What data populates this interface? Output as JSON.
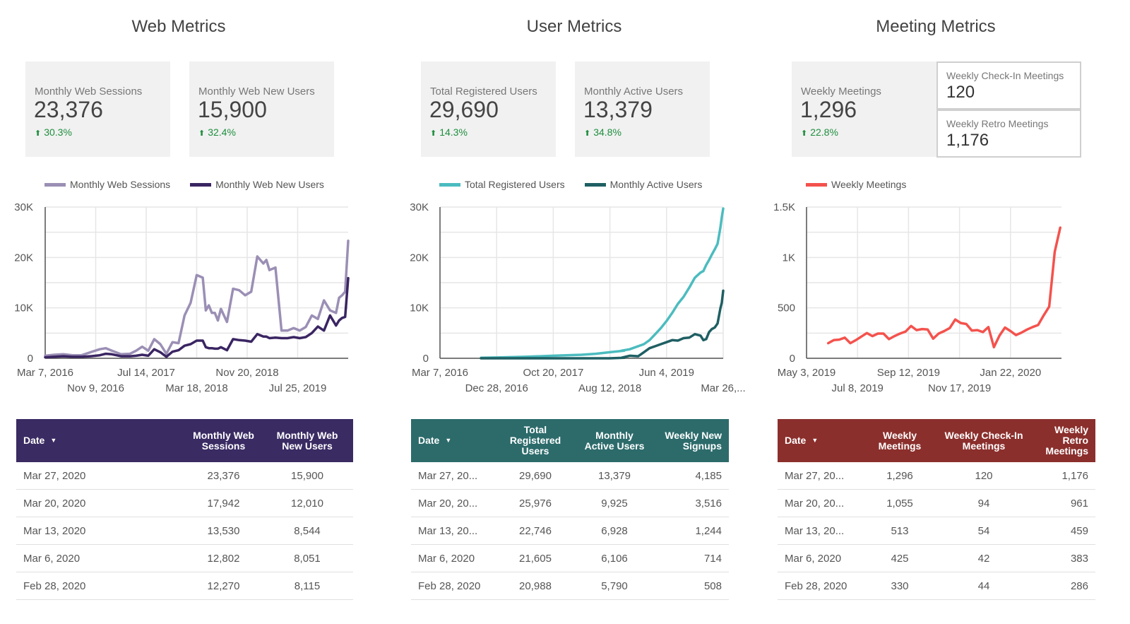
{
  "sections": [
    {
      "title": "Web Metrics",
      "cards": [
        {
          "label": "Monthly Web Sessions",
          "value": "23,376",
          "delta": "30.3%",
          "delta_direction": "up"
        },
        {
          "label": "Monthly Web New Users",
          "value": "15,900",
          "delta": "32.4%",
          "delta_direction": "up"
        }
      ],
      "table": {
        "header_color": "#3a2b63",
        "sort_icon": "triangle-down",
        "columns": [
          "Date",
          "Monthly Web Sessions",
          "Monthly Web New Users"
        ],
        "rows": [
          [
            "Mar 27, 2020",
            "23,376",
            "15,900"
          ],
          [
            "Mar 20, 2020",
            "17,942",
            "12,010"
          ],
          [
            "Mar 13, 2020",
            "13,530",
            "8,544"
          ],
          [
            "Mar 6, 2020",
            "12,802",
            "8,051"
          ],
          [
            "Feb 28, 2020",
            "12,270",
            "8,115"
          ]
        ]
      }
    },
    {
      "title": "User Metrics",
      "cards": [
        {
          "label": "Total Registered Users",
          "value": "29,690",
          "delta": "14.3%",
          "delta_direction": "up"
        },
        {
          "label": "Monthly Active Users",
          "value": "13,379",
          "delta": "34.8%",
          "delta_direction": "up"
        }
      ],
      "table": {
        "header_color": "#2d6b6b",
        "sort_icon": "triangle-down",
        "columns": [
          "Date",
          "Total Registered Users",
          "Monthly Active Users",
          "Weekly New Signups"
        ],
        "rows": [
          [
            "Mar 27, 20...",
            "29,690",
            "13,379",
            "4,185"
          ],
          [
            "Mar 20, 20...",
            "25,976",
            "9,925",
            "3,516"
          ],
          [
            "Mar 13, 20...",
            "22,746",
            "6,928",
            "1,244"
          ],
          [
            "Mar 6, 2020",
            "21,605",
            "6,106",
            "714"
          ],
          [
            "Feb 28, 2020",
            "20,988",
            "5,790",
            "508"
          ]
        ]
      }
    },
    {
      "title": "Meeting Metrics",
      "cards": [
        {
          "label": "Weekly Meetings",
          "value": "1,296",
          "delta": "22.8%",
          "delta_direction": "up"
        }
      ],
      "mini_cards": [
        {
          "label": "Weekly Check-In Meetings",
          "value": "120"
        },
        {
          "label": "Weekly Retro Meetings",
          "value": "1,176"
        }
      ],
      "table": {
        "header_color": "#8b2f2c",
        "sort_icon": "triangle-down",
        "columns": [
          "Date",
          "Weekly Meetings",
          "Weekly Check-In Meetings",
          "Weekly Retro Meetings"
        ],
        "rows": [
          [
            "Mar 27, 20...",
            "1,296",
            "120",
            "1,176"
          ],
          [
            "Mar 20, 20...",
            "1,055",
            "94",
            "961"
          ],
          [
            "Mar 13, 20...",
            "513",
            "54",
            "459"
          ],
          [
            "Mar 6, 2020",
            "425",
            "42",
            "383"
          ],
          [
            "Feb 28, 2020",
            "330",
            "44",
            "286"
          ]
        ]
      }
    }
  ],
  "chart_data": [
    {
      "type": "line",
      "title": "Web Metrics",
      "xlabel": "",
      "ylabel": "",
      "x_range": [
        "Mar 7, 2016",
        "Mar 27, 2020"
      ],
      "x_ticks": [
        "Mar 7, 2016",
        "Nov 9, 2016",
        "Jul 14, 2017",
        "Mar 18, 2018",
        "Nov 20, 2018",
        "Jul 25, 2019"
      ],
      "y_ticks": [
        "0",
        "10K",
        "20K",
        "30K"
      ],
      "ylim": [
        0,
        30000
      ],
      "grid": true,
      "legend": "top",
      "x_fraction": [
        0,
        0.03,
        0.06,
        0.09,
        0.12,
        0.15,
        0.18,
        0.2,
        0.22,
        0.25,
        0.28,
        0.3,
        0.32,
        0.34,
        0.36,
        0.38,
        0.4,
        0.42,
        0.44,
        0.46,
        0.48,
        0.5,
        0.52,
        0.53,
        0.54,
        0.55,
        0.56,
        0.57,
        0.58,
        0.6,
        0.62,
        0.64,
        0.66,
        0.68,
        0.7,
        0.72,
        0.73,
        0.74,
        0.76,
        0.78,
        0.8,
        0.82,
        0.84,
        0.86,
        0.88,
        0.9,
        0.92,
        0.94,
        0.96,
        0.97,
        0.98,
        0.99,
        1.0
      ],
      "series": [
        {
          "name": "Monthly Web Sessions",
          "color": "#9b8fb5",
          "values": [
            500,
            700,
            800,
            600,
            600,
            1200,
            1800,
            2000,
            1500,
            800,
            900,
            1500,
            2300,
            1500,
            3800,
            2800,
            900,
            3200,
            3000,
            8500,
            11000,
            16500,
            16000,
            9500,
            10500,
            9000,
            9000,
            7500,
            9800,
            7200,
            13800,
            13500,
            12500,
            13200,
            20200,
            18800,
            19500,
            17500,
            18000,
            5500,
            5500,
            6000,
            5500,
            6200,
            8500,
            7800,
            11500,
            9500,
            9000,
            12000,
            12500,
            13200,
            23300
          ]
        },
        {
          "name": "Monthly Web New Users",
          "color": "#3a2562",
          "values": [
            200,
            300,
            400,
            300,
            300,
            400,
            600,
            900,
            800,
            400,
            400,
            500,
            700,
            500,
            1800,
            1200,
            300,
            1300,
            1600,
            2500,
            2800,
            3500,
            3500,
            2200,
            2000,
            2000,
            1900,
            1900,
            2200,
            1600,
            3800,
            3600,
            3500,
            3300,
            4800,
            4300,
            4300,
            4000,
            4100,
            4000,
            4000,
            4200,
            4000,
            4200,
            5000,
            6300,
            5500,
            8500,
            6500,
            7500,
            8000,
            8200,
            15900
          ]
        }
      ]
    },
    {
      "type": "line",
      "title": "User Metrics",
      "xlabel": "",
      "ylabel": "",
      "x_range": [
        "Mar 7, 2016",
        "Mar 27, 2020"
      ],
      "x_ticks": [
        "Mar 7, 2016",
        "Dec 28, 2016",
        "Oct 20, 2017",
        "Aug 12, 2018",
        "Jun 4, 2019",
        "Mar 26,..."
      ],
      "y_ticks": [
        "0",
        "10K",
        "20K",
        "30K"
      ],
      "ylim": [
        0,
        30000
      ],
      "grid": true,
      "legend": "top",
      "x_fraction": [
        0.145,
        0.2,
        0.3,
        0.4,
        0.5,
        0.55,
        0.6,
        0.65,
        0.64,
        0.67,
        0.7,
        0.72,
        0.74,
        0.76,
        0.78,
        0.8,
        0.82,
        0.84,
        0.86,
        0.88,
        0.9,
        0.92,
        0.93,
        0.94,
        0.95,
        0.96,
        0.97,
        0.98,
        0.99,
        0.995,
        1.0
      ],
      "series": [
        {
          "name": "Total Registered Users",
          "color": "#4bbcbf",
          "values": [
            100,
            150,
            300,
            500,
            700,
            900,
            1200,
            1500,
            1500,
            1800,
            2400,
            2800,
            3600,
            4800,
            6000,
            7400,
            9000,
            10800,
            12200,
            14000,
            16000,
            17000,
            17300,
            18500,
            19500,
            20600,
            21600,
            22700,
            25900,
            28000,
            29700
          ]
        },
        {
          "name": "Monthly Active Users",
          "color": "#1f5f63",
          "values": [
            0,
            0,
            0,
            0,
            0,
            0,
            0,
            100,
            100,
            500,
            400,
            1200,
            2000,
            2400,
            2800,
            3200,
            3600,
            3500,
            4000,
            4100,
            4800,
            4500,
            3600,
            3800,
            5200,
            5800,
            6100,
            6900,
            9900,
            11000,
            13400
          ]
        }
      ]
    },
    {
      "type": "line",
      "title": "Meeting Metrics",
      "xlabel": "",
      "ylabel": "",
      "x_range": [
        "May 3, 2019",
        "Mar 27, 2020"
      ],
      "x_ticks": [
        "May 3, 2019",
        "Jul 8, 2019",
        "Sep 12, 2019",
        "Nov 17, 2019",
        "Jan 22, 2020"
      ],
      "y_ticks": [
        "0",
        "500",
        "1K",
        "1.5K"
      ],
      "ylim": [
        0,
        1500
      ],
      "grid": true,
      "legend": "top-left",
      "series": [
        {
          "name": "Weekly Meetings",
          "color": "#f4524d",
          "values": [
            150,
            180,
            185,
            205,
            150,
            180,
            215,
            250,
            220,
            245,
            245,
            190,
            220,
            245,
            265,
            320,
            280,
            290,
            285,
            195,
            245,
            270,
            300,
            385,
            350,
            340,
            275,
            280,
            260,
            310,
            110,
            225,
            305,
            270,
            230,
            255,
            285,
            310,
            330,
            425,
            513,
            1055,
            1296
          ]
        }
      ]
    }
  ]
}
